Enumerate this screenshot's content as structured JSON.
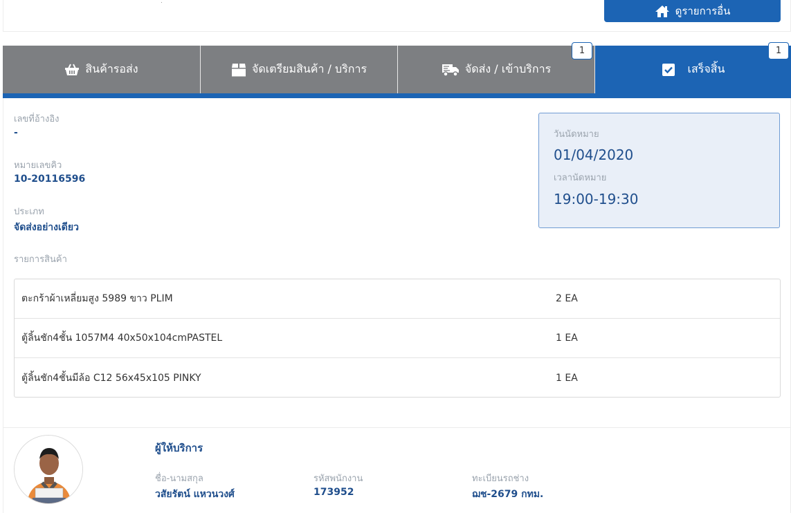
{
  "header": {
    "other_button_label": "ดูรายการอื่น",
    "other_button_icon": "home-icon"
  },
  "tabs": [
    {
      "label": "สินค้ารอส่ง",
      "icon": "basket-icon",
      "badge": ""
    },
    {
      "label": "จัดเตรียมสินค้า / บริการ",
      "icon": "box-icon",
      "badge": ""
    },
    {
      "label": "จัดส่ง / เข้าบริการ",
      "icon": "truck-icon",
      "badge": "1"
    },
    {
      "label": "เสร็จสิ้น",
      "icon": "checkbox-icon",
      "badge": "1",
      "active": true
    }
  ],
  "colors": {
    "primary": "#1c64b4",
    "tab_inactive": "#7d7f82",
    "value_text": "#1f4e8c",
    "label_text": "#9aa3ad"
  },
  "details": {
    "reference_label": "เลขที่อ้างอิง",
    "reference_value": "-",
    "queue_label": "หมายเลขคิว",
    "queue_value": "10-20116596",
    "type_label": "ประเภท",
    "type_value": "จัดส่งอย่างเดียว",
    "items_label": "รายการสินค้า"
  },
  "appointment": {
    "date_label": "วันนัดหมาย",
    "date_value": "01/04/2020",
    "time_label": "เวลานัดหมาย",
    "time_value": "19:00-19:30"
  },
  "items": [
    {
      "name": "ตะกร้าผ้าเหลี่ยมสูง 5989 ขาว PLIM",
      "qty": "2 EA"
    },
    {
      "name": "ตู้ลิ้นชัก4ชั้น 1057M4 40x50x104cmPASTEL",
      "qty": "1 EA"
    },
    {
      "name": "ตู้ลิ้นชัก4ชั้นมีล้อ C12 56x45x105 PINKY",
      "qty": "1 EA"
    }
  ],
  "provider": {
    "title": "ผู้ให้บริการ",
    "name_label": "ชื่อ-นามสกุล",
    "name_value": "วสัยรัตน์ แหวนวงศ์",
    "employee_label": "รหัสพนักงาน",
    "employee_value": "173952",
    "plate_label": "ทะเบียนรถช่าง",
    "plate_value": "ฌช-2679 กทม."
  }
}
